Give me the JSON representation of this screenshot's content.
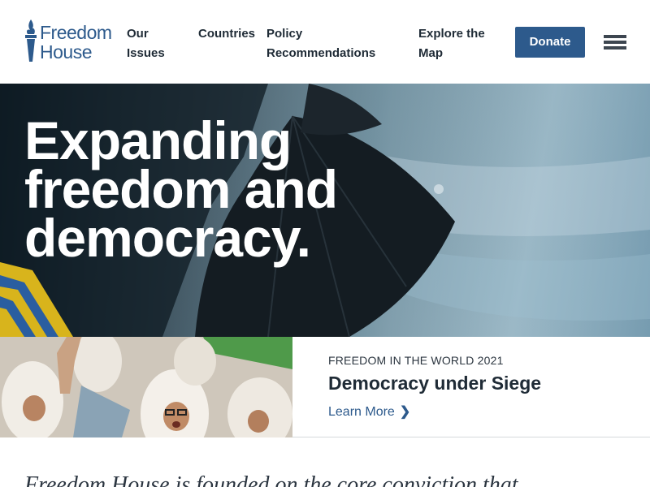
{
  "header": {
    "logo_line1": "Freedom",
    "logo_line2": "House",
    "nav": [
      {
        "label_line1": "Our",
        "label_line2": "Issues"
      },
      {
        "label_line1": "Countries",
        "label_line2": ""
      },
      {
        "label_line1": "Policy",
        "label_line2": "Recommendations"
      },
      {
        "label_line1": "Explore the",
        "label_line2": "Map"
      }
    ],
    "donate_label": "Donate"
  },
  "hero": {
    "title_line1": "Expanding",
    "title_line2": "freedom and",
    "title_line3": "democracy."
  },
  "feature": {
    "eyebrow": "FREEDOM IN THE WORLD 2021",
    "title": "Democracy under Siege",
    "link_label": "Learn More",
    "link_icon": "chevron-right-icon"
  },
  "intro": {
    "text": "Freedom House is founded on the core conviction that"
  },
  "colors": {
    "brand_blue": "#2d5a8c",
    "text_dark": "#1f2b36"
  }
}
